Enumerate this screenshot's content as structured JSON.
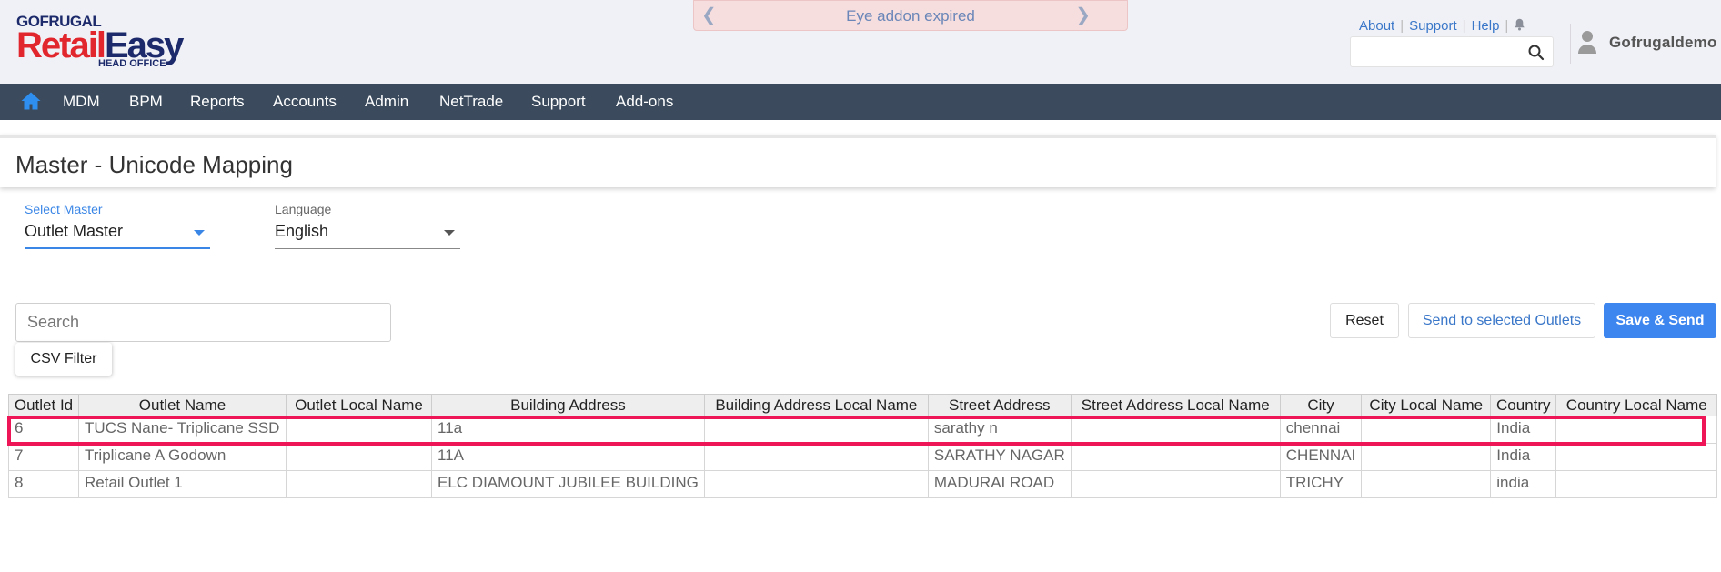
{
  "header": {
    "logo_top": "GOFRUGAL",
    "logo_retail": "Retail",
    "logo_easy": "Easy",
    "logo_sub": "HEAD OFFICE",
    "banner_text": "Eye addon expired",
    "links": {
      "about": "About",
      "support": "Support",
      "help": "Help"
    },
    "username": "Gofrugaldemo"
  },
  "nav": {
    "items": [
      "MDM",
      "BPM",
      "Reports",
      "Accounts",
      "Admin",
      "NetTrade",
      "Support",
      "Add-ons"
    ]
  },
  "page": {
    "title": "Master - Unicode Mapping"
  },
  "filters": {
    "master_label": "Select Master",
    "master_value": "Outlet Master",
    "language_label": "Language",
    "language_value": "English",
    "search_placeholder": "Search",
    "csv_filter": "CSV Filter"
  },
  "actions": {
    "reset": "Reset",
    "send_selected": "Send to selected Outlets",
    "save_send": "Save & Send"
  },
  "table": {
    "columns": [
      "Outlet Id",
      "Outlet Name",
      "Outlet Local Name",
      "Building Address",
      "Building Address Local Name",
      "Street Address",
      "Street Address Local Name",
      "City",
      "City Local Name",
      "Country",
      "Country Local Name"
    ],
    "rows": [
      [
        "6",
        "TUCS Nane- Triplicane SSD",
        "",
        "11a",
        "",
        "sarathy n",
        "",
        "chennai",
        "",
        "India",
        ""
      ],
      [
        "7",
        "Triplicane A Godown",
        "",
        "11A",
        "",
        "SARATHY NAGAR",
        "",
        "CHENNAI",
        "",
        "India",
        ""
      ],
      [
        "8",
        "Retail Outlet 1",
        "",
        "ELC DIAMOUNT JUBILEE BUILDING",
        "",
        "MADURAI ROAD",
        "",
        "TRICHY",
        "",
        "india",
        ""
      ]
    ],
    "highlighted_row": 0
  },
  "colors": {
    "navbar": "#3b4b5d",
    "accent": "#3e86ef",
    "highlight": "#ee1657"
  }
}
